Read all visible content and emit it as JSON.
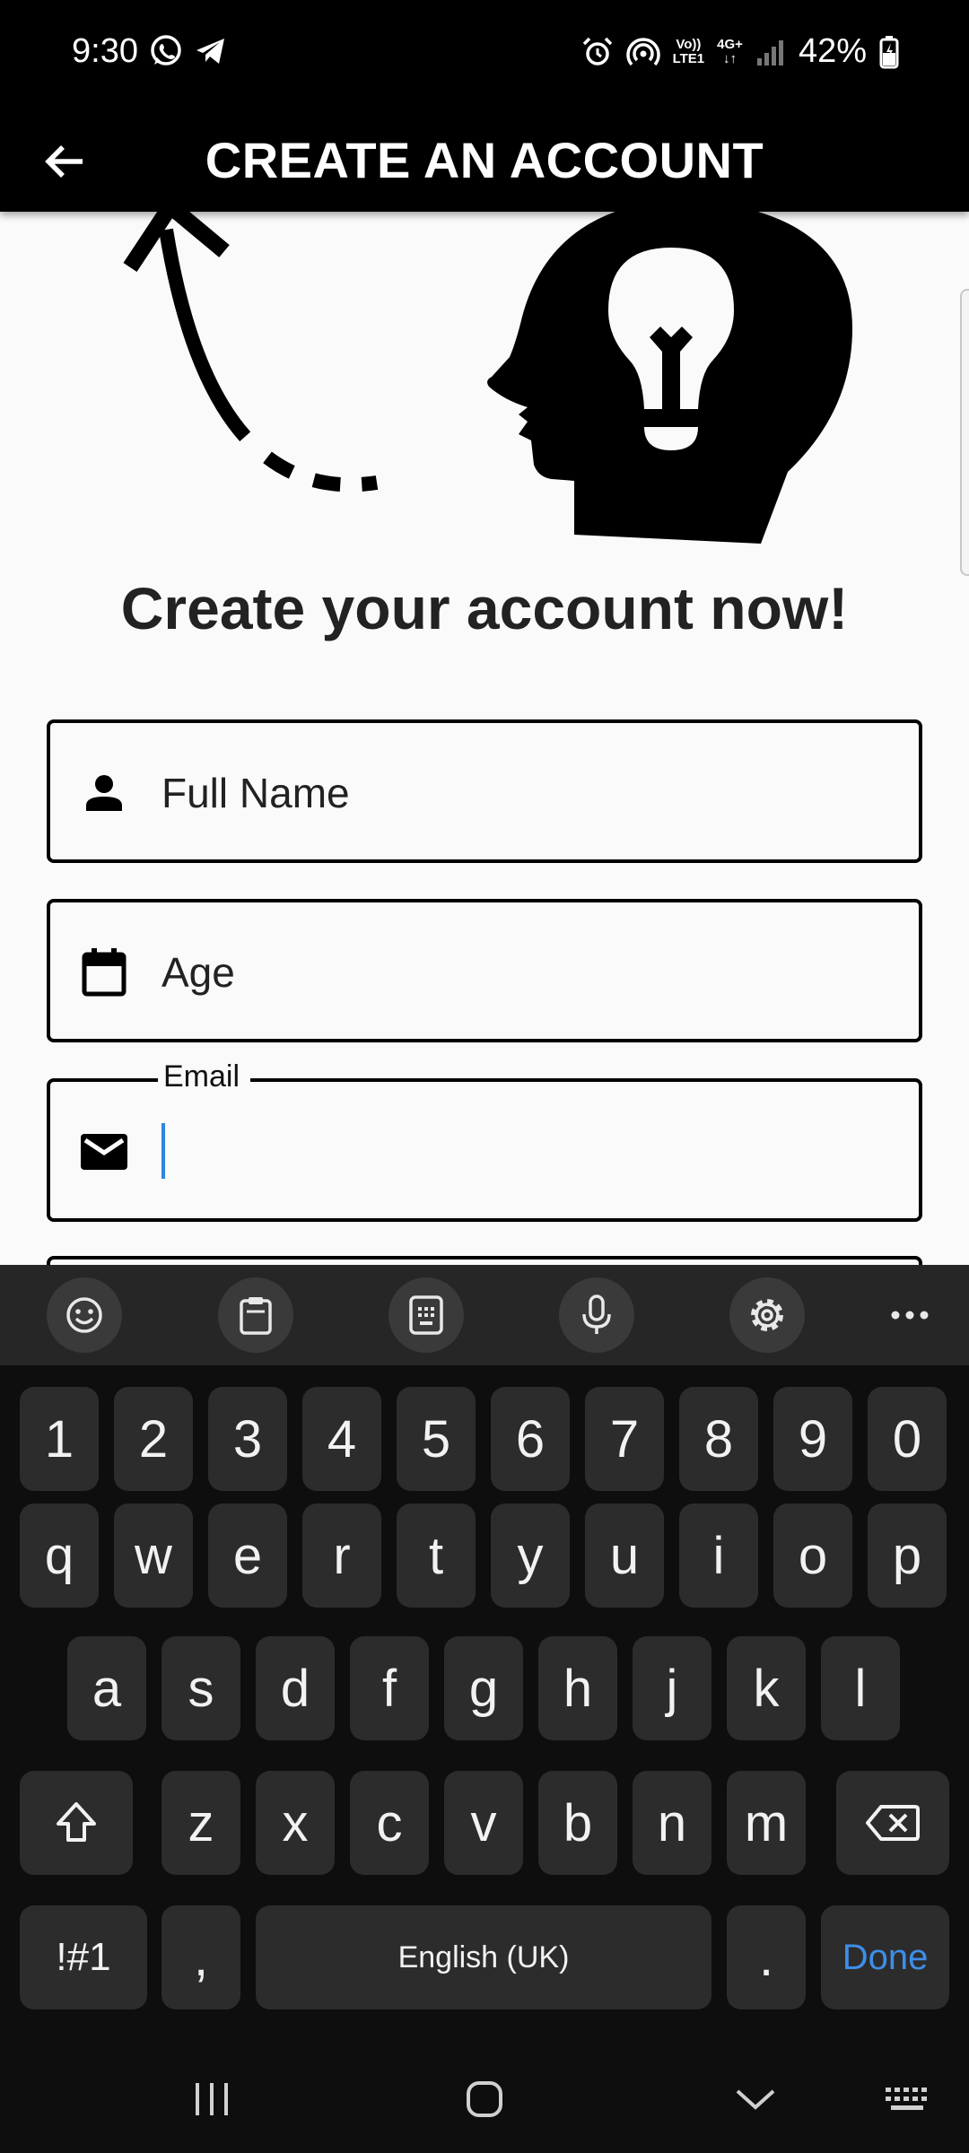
{
  "status_bar": {
    "time": "9:30",
    "volte_line1": "Vo))",
    "volte_line2": "LTE1",
    "network_type": "4G+",
    "battery_percent": "42%"
  },
  "app_bar": {
    "title": "CREATE AN ACCOUNT"
  },
  "main": {
    "heading": "Create your account now!",
    "fields": {
      "full_name": {
        "placeholder": "Full Name",
        "icon": "person-icon"
      },
      "age": {
        "placeholder": "Age",
        "icon": "calendar-icon"
      },
      "email": {
        "label": "Email",
        "value": "",
        "icon": "mail-icon"
      }
    }
  },
  "keyboard": {
    "toolbar": [
      "emoji-icon",
      "clipboard-icon",
      "keypad-icon",
      "microphone-icon",
      "settings-icon",
      "more-icon"
    ],
    "rows": {
      "numbers": [
        "1",
        "2",
        "3",
        "4",
        "5",
        "6",
        "7",
        "8",
        "9",
        "0"
      ],
      "row1": [
        "q",
        "w",
        "e",
        "r",
        "t",
        "y",
        "u",
        "i",
        "o",
        "p"
      ],
      "row2": [
        "a",
        "s",
        "d",
        "f",
        "g",
        "h",
        "j",
        "k",
        "l"
      ],
      "row3": [
        "z",
        "x",
        "c",
        "v",
        "b",
        "n",
        "m"
      ]
    },
    "symbols_label": "!#1",
    "comma_label": ",",
    "space_label": "English (UK)",
    "period_label": ".",
    "done_label": "Done"
  },
  "colors": {
    "accent": "#3e8ee8",
    "caret": "#2e86de",
    "app_bar": "#000000",
    "background": "#fafafa"
  }
}
